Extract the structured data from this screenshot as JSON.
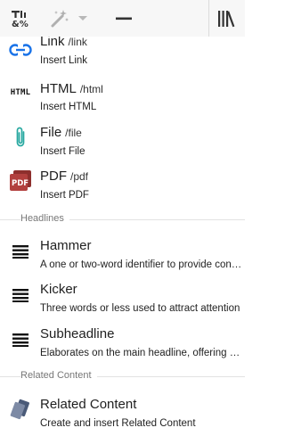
{
  "colors": {
    "link_icon": "#1a73e8",
    "file_icon": "#27a8a0",
    "pdf_icon": "#b2403e",
    "related_icon": "#4a5a78"
  },
  "toolbar": {
    "icons": [
      "text-format-icon",
      "magic-wand-icon",
      "chevron-down-icon",
      "horizontal-rule-icon",
      "library-icon"
    ]
  },
  "menu": {
    "items_top": [
      {
        "title": "Link",
        "cmd": "/link",
        "desc": "Insert Link",
        "icon": "link-icon"
      },
      {
        "title": "HTML",
        "cmd": "/html",
        "desc": "Insert HTML",
        "icon": "html-icon",
        "icon_text": "HTML"
      },
      {
        "title": "File",
        "cmd": "/file",
        "desc": "Insert File",
        "icon": "paperclip-icon"
      },
      {
        "title": "PDF",
        "cmd": "/pdf",
        "desc": "Insert PDF",
        "icon": "pdf-icon",
        "icon_text": "PDF"
      }
    ],
    "sections": [
      {
        "label": "Headlines",
        "items": [
          {
            "title": "Hammer",
            "desc": "A one or two-word identifier to provide context or category",
            "icon": "text-lines-icon"
          },
          {
            "title": "Kicker",
            "desc": "Three words or less used to attract attention",
            "icon": "text-lines-icon"
          },
          {
            "title": "Subheadline",
            "desc": "Elaborates on the main headline, offering more detail",
            "icon": "text-lines-icon"
          }
        ]
      },
      {
        "label": "Related Content",
        "items": [
          {
            "title": "Related Content",
            "desc": "Create and insert Related Content",
            "icon": "related-content-icon"
          }
        ]
      }
    ]
  }
}
